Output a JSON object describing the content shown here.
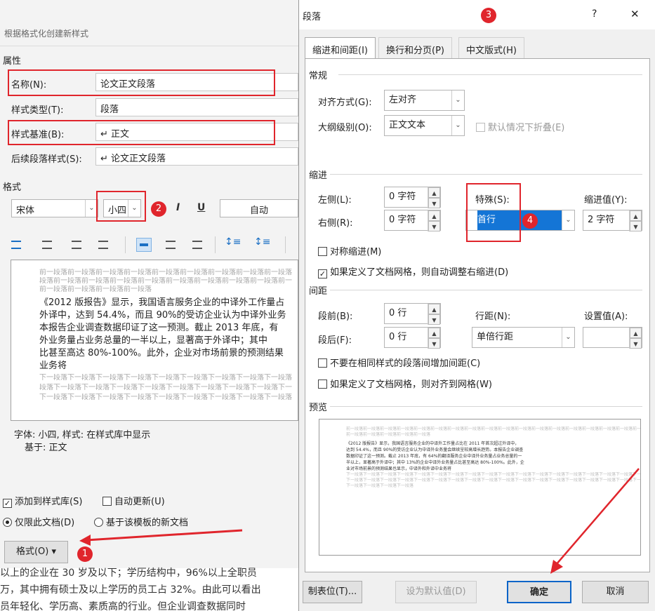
{
  "left": {
    "title": "根据格式化创建新样式",
    "props_title": "属性",
    "name_label": "名称(N):",
    "name_value": "论文正文段落",
    "type_label": "样式类型(T):",
    "type_value": "段落",
    "base_label": "样式基准(B):",
    "base_value": "↵ 正文",
    "next_label": "后续段落样式(S):",
    "next_value": "↵ 论文正文段落",
    "format_title": "格式",
    "font": "宋体",
    "size": "小四",
    "bold": "B",
    "italic": "I",
    "underline": "U",
    "color": "自动",
    "preview_prev": [
      "前一段落前一段落前一段落前一段落前一段落前一段落前一段落前一段落前一段落",
      "段落前一段落前一段落前一段落前一段落前一段落前一段落前一段落前一段落前一",
      "前一段落前一段落前一段落前一段落"
    ],
    "preview_body": [
      "《2012 版报告》显示，我国语言服务企业的中译外工作量占",
      "外译中，达到 54.4%，而且 90%的受访企业认为中译外业务",
      "本报告企业调查数据印证了这一预测。截止 2013 年底，有",
      "外业务量占业务总量的一半以上，显著高于外译中；其中",
      "比甚至高达 80%-100%。此外，企业对市场前景的预测结果",
      "业务将"
    ],
    "preview_next": [
      "下一段落下一段落下一段落下一段落下一段落下一段落下一段落下一段落下一段落",
      "段落下一段落下一段落下一段落下一段落下一段落下一段落下一段落下一段落下一",
      "下一段落下一段落下一段落下一段落下一段落下一段落下一段落下一段落下一段落"
    ],
    "desc_line1": "字体: 小四, 样式: 在样式库中显示",
    "desc_line2": "基于: 正文",
    "add_gallery": "添加到样式库(S)",
    "auto_update": "自动更新(U)",
    "only_doc": "仅限此文档(D)",
    "template_doc": "基于该模板的新文档",
    "format_btn": "格式(O) ▾",
    "doc_line1": "以上的企业在 30 岁及以下；学历结构中，96%以上全职员",
    "doc_line2": "万，其中拥有硕士及以上学历的员工占 32%。由此可以看出",
    "doc_line3": "员年轻化、学历高、素质高的行业。但企业调查数据同时"
  },
  "right": {
    "title": "段落",
    "help": "?",
    "close": "✕",
    "tabs": [
      "缩进和间距(I)",
      "换行和分页(P)",
      "中文版式(H)"
    ],
    "general": "常规",
    "align_label": "对齐方式(G):",
    "align_value": "左对齐",
    "outline_label": "大纲级别(O):",
    "outline_value": "正文文本",
    "collapse_label": "默认情况下折叠(E)",
    "indent": "缩进",
    "left_label": "左侧(L):",
    "left_value": "0 字符",
    "right_label": "右侧(R):",
    "right_value": "0 字符",
    "special_label": "特殊(S):",
    "special_value": "首行",
    "indent_by_label": "缩进值(Y):",
    "indent_by_value": "2 字符",
    "mirror": "对称缩进(M)",
    "auto_adjust": "如果定义了文档网格，则自动调整右缩进(D)",
    "spacing": "间距",
    "before_label": "段前(B):",
    "before_value": "0 行",
    "after_label": "段后(F):",
    "after_value": "0 行",
    "line_label": "行距(N):",
    "line_value": "单倍行距",
    "at_label": "设置值(A):",
    "at_value": "",
    "no_space": "不要在相同样式的段落间增加间距(C)",
    "snap_grid": "如果定义了文档网格，则对齐到网格(W)",
    "preview": "预览",
    "pv_prev": [
      "前一段落前一段落前一段落前一段落前一段落前一段落前一段落前一段落前一段落前一段落前一段落前一段落前一段落前一段落前一段落前一段落前一段落前一段落前一段落前一段落前一段落",
      "前一段落前一段落前一段落前一段落前一段落"
    ],
    "pv_body": [
      "《2012 版报告》显示，我国语言服务企业的中译外工作量占比在 2011 年首次超过外译中，",
      "达到 54.4%，而且 90%的受访企业认为中译外业务量会继续呈较高增长趋势。本报告企业调查",
      "数据印证了这一预测。截止 2013 年底，有 64%的翻译服务企业中译外业务量占业务总量的一",
      "半以上，显著高于外译中；其中 13%的企业中译外业务量占比甚至高达 80%-100%。此外，企",
      "业对市场前景的预测结果也显示，中译外和外译中业务将"
    ],
    "pv_next": [
      "下一段落下一段落下一段落下一段落下一段落下一段落下一段落下一段落下一段落下一段落下一段落下一段落下一段落下一段落下一段落下一段落下一段落下一段落下一段落下一段落下一段落",
      "下一段落下一段落下一段落下一段落下一段落下一段落下一段落下一段落下一段落下一段落下一段落下一段落下一段落下一段落下一段落下一段落下一段落下一段落下一段落下一段落下一段落",
      "下一段落下一段落下一段落下一段落"
    ],
    "tabs_btn": "制表位(T)...",
    "default_btn": "设为默认值(D)",
    "ok_btn": "确定",
    "cancel_btn": "取消"
  },
  "badges": [
    "1",
    "2",
    "3",
    "4"
  ],
  "accent": "#e0252c"
}
